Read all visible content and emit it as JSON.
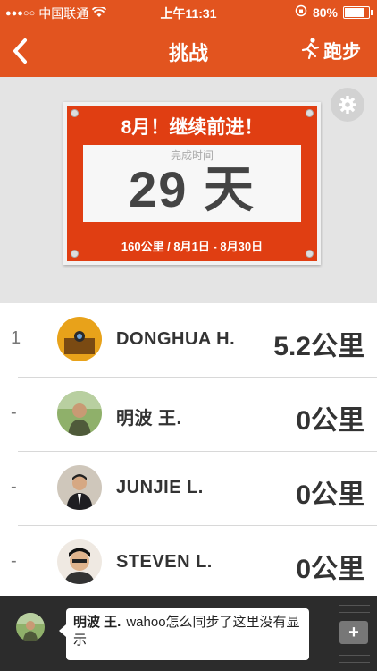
{
  "status": {
    "carrier": "中国联通",
    "time": "上午11:31",
    "battery": "80%",
    "battery_level": 0.8
  },
  "nav": {
    "title": "挑战",
    "run_label": "跑步"
  },
  "challenge": {
    "headline": "8月！继续前进！",
    "caption": "完成时间",
    "days": "29 天",
    "footer": "160公里 / 8月1日 - 8月30日"
  },
  "leaderboard": [
    {
      "rank": "1",
      "name": "DONGHUA H.",
      "distance": "5.2公里"
    },
    {
      "rank": "-",
      "name": "明波 王.",
      "distance": "0公里"
    },
    {
      "rank": "-",
      "name": "JUNJIE L.",
      "distance": "0公里"
    },
    {
      "rank": "-",
      "name": "STEVEN L.",
      "distance": "0公里"
    }
  ],
  "chat": {
    "author": "明波 王.",
    "message": "wahoo怎么同步了这里没有显示"
  },
  "colors": {
    "brand": "#e2541f",
    "banner": "#e03e12"
  },
  "icons": [
    "back-icon",
    "runner-icon",
    "gear-icon",
    "wifi-icon",
    "lock-rotation-icon",
    "battery-icon",
    "plus-icon"
  ]
}
